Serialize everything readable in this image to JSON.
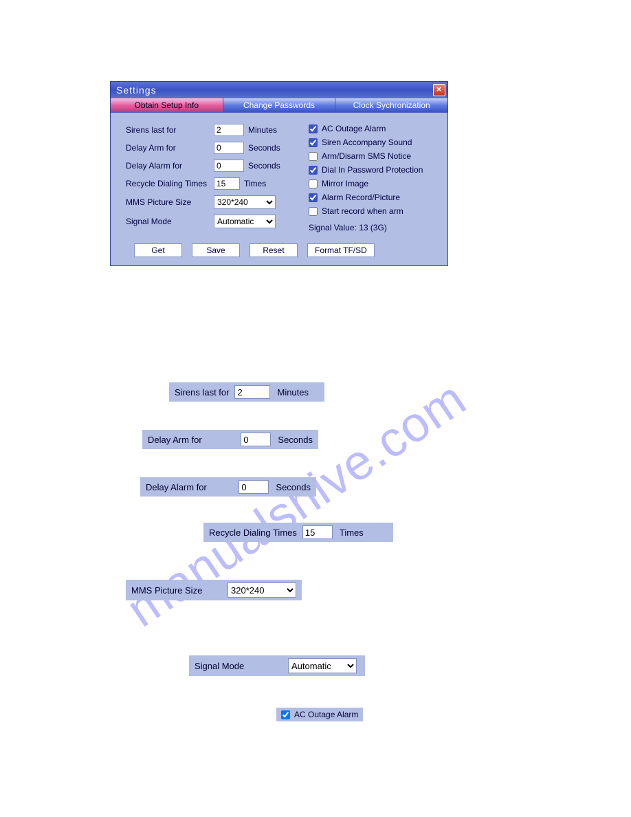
{
  "watermark": "manualshive.com",
  "window": {
    "title": "Settings",
    "tabs": [
      {
        "label": "Obtain Setup Info",
        "active": true
      },
      {
        "label": "Change Passwords",
        "active": false
      },
      {
        "label": "Clock Sychronization",
        "active": false
      }
    ],
    "fields": {
      "sirens": {
        "label": "Sirens last for",
        "value": "2",
        "unit": "Minutes"
      },
      "delay_arm": {
        "label": "Delay Arm for",
        "value": "0",
        "unit": "Seconds"
      },
      "delay_alarm": {
        "label": "Delay Alarm for",
        "value": "0",
        "unit": "Seconds"
      },
      "recycle": {
        "label": "Recycle Dialing Times",
        "value": "15",
        "unit": "Times"
      },
      "mms": {
        "label": "MMS Picture Size",
        "value": "320*240"
      },
      "signal_mode": {
        "label": "Signal Mode",
        "value": "Automatic"
      }
    },
    "checks": {
      "ac_outage": {
        "label": "AC Outage Alarm",
        "checked": true
      },
      "siren_sound": {
        "label": "Siren Accompany Sound",
        "checked": true
      },
      "sms_notice": {
        "label": "Arm/Disarm SMS Notice",
        "checked": false
      },
      "dial_pwd": {
        "label": "Dial In Password Protection",
        "checked": true
      },
      "mirror": {
        "label": "Mirror Image",
        "checked": false
      },
      "alarm_rec": {
        "label": "Alarm Record/Picture",
        "checked": true
      },
      "start_rec": {
        "label": "Start record when arm",
        "checked": false
      }
    },
    "signal_value": "Signal Value:  13 (3G)",
    "buttons": {
      "get": "Get",
      "save": "Save",
      "reset": "Reset",
      "format": "Format TF/SD"
    }
  },
  "snippets": {
    "sirens": {
      "label": "Sirens last for",
      "value": "2",
      "unit": "Minutes"
    },
    "delay_arm": {
      "label": "Delay Arm for",
      "value": "0",
      "unit": "Seconds"
    },
    "delay_alarm": {
      "label": "Delay Alarm for",
      "value": "0",
      "unit": "Seconds"
    },
    "recycle": {
      "label": "Recycle Dialing Times",
      "value": "15",
      "unit": "Times"
    },
    "mms": {
      "label": "MMS Picture Size",
      "value": "320*240"
    },
    "signal_mode": {
      "label": "Signal Mode",
      "value": "Automatic"
    },
    "ac_outage": {
      "label": "AC Outage Alarm",
      "checked": true
    }
  }
}
